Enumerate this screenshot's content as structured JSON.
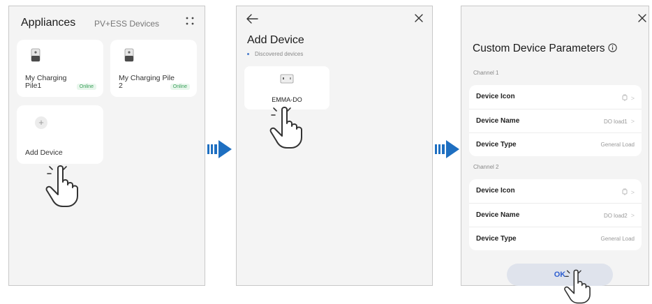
{
  "colors": {
    "panel_bg": "#f4f4f4",
    "card_bg": "#ffffff",
    "flow_arrow": "#1e6fc1",
    "online": "#3aa05a",
    "ok_text": "#2f5fd0",
    "ok_bg": "#dfe3ec"
  },
  "appliances": {
    "title": "Appliances",
    "subtitle": "PV+ESS Devices",
    "menu_icon": "grid-dots-icon",
    "devices": [
      {
        "name": "My Charging Pile1",
        "status": "Online",
        "icon": "charging-pile-icon"
      },
      {
        "name": "My Charging Pile 2",
        "status": "Online",
        "icon": "charging-pile-icon"
      }
    ],
    "add_device_label": "Add Device",
    "add_icon": "plus-icon"
  },
  "add_device": {
    "back_icon": "back-arrow-icon",
    "close_icon": "close-icon",
    "title": "Add Device",
    "section_label": "Discovered devices",
    "discovered": [
      {
        "name": "EMMA-DO",
        "icon": "emma-device-icon"
      }
    ]
  },
  "custom_params": {
    "close_icon": "close-icon",
    "title": "Custom Device Parameters",
    "info_icon": "info-icon",
    "channels": [
      {
        "label": "Channel 1",
        "rows": [
          {
            "key": "Device Icon",
            "value": ""
          },
          {
            "key": "Device Name",
            "value": "DO load1"
          },
          {
            "key": "Device Type",
            "value": "General Load"
          }
        ]
      },
      {
        "label": "Channel 2",
        "rows": [
          {
            "key": "Device Icon",
            "value": ""
          },
          {
            "key": "Device Name",
            "value": "DO load2"
          },
          {
            "key": "Device Type",
            "value": "General Load"
          }
        ]
      }
    ],
    "ok_label": "OK"
  }
}
